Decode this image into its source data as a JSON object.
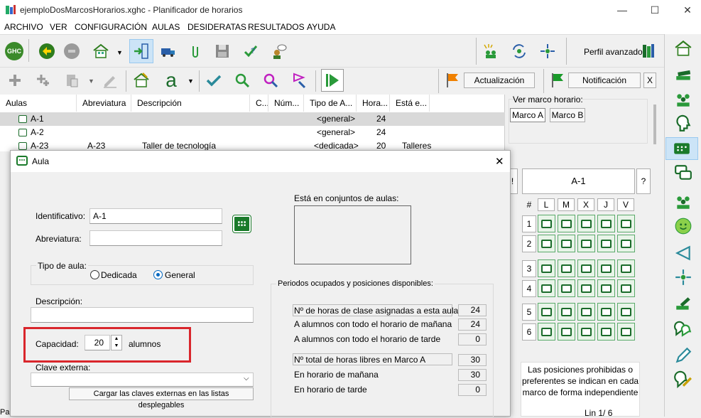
{
  "window": {
    "title": "ejemploDosMarcosHorarios.xghc - Planificador de horarios",
    "minimize": "—",
    "maximize": "☐",
    "close": "✕"
  },
  "menu": [
    "ARCHIVO",
    "VER",
    "CONFIGURACIÓN",
    "AULAS",
    "DESIDERATAS",
    "RESULTADOS",
    "AYUDA"
  ],
  "toolbar": {
    "ghc_label": "GHC",
    "perfil_label": "Perfil avanzado",
    "actualizacion_label": "Actualización",
    "notificacion_label": "Notificación",
    "close_x": "X",
    "font_a": "a"
  },
  "table": {
    "headers": [
      "Aulas",
      "Abreviatura",
      "Descripción",
      "C...",
      "Núm...",
      "Tipo de A...",
      "Hora...",
      "Está e..."
    ],
    "rows": [
      {
        "aula": "A-1",
        "abrev": "",
        "desc": "",
        "tipo": "<general>",
        "horas": "24",
        "esta": ""
      },
      {
        "aula": "A-2",
        "abrev": "",
        "desc": "",
        "tipo": "<general>",
        "horas": "24",
        "esta": ""
      },
      {
        "aula": "A-23",
        "abrev": "A-23",
        "desc": "Taller de tecnología",
        "tipo": "<dedicada>",
        "horas": "20",
        "esta": "Talleres"
      }
    ]
  },
  "right": {
    "ver_marco": "Ver marco horario:",
    "marco_a": "Marco A",
    "marco_b": "Marco B",
    "excl": "!",
    "aula_name": "A-1",
    "question": "?",
    "hash": "#",
    "days": [
      "L",
      "M",
      "X",
      "J",
      "V"
    ],
    "periods": [
      "1",
      "2",
      "3",
      "4",
      "5",
      "6"
    ],
    "note": "Las posiciones prohibidas o preferentes se indican en cada marco de forma independiente",
    "lin": "Lin 1/ 6"
  },
  "dialog": {
    "title": "Aula",
    "close": "✕",
    "identificativo_label": "Identificativo:",
    "identificativo_value": "A-1",
    "abreviatura_label": "Abreviatura:",
    "abreviatura_value": "",
    "tipo_label": "Tipo de aula:",
    "dedicada": "Dedicada",
    "general": "General",
    "descripcion_label": "Descripción:",
    "descripcion_value": "",
    "capacidad_label": "Capacidad:",
    "capacidad_value": "20",
    "alumnos": "alumnos",
    "clave_label": "Clave externa:",
    "clave_value": "",
    "cargar_btn": "Cargar las claves externas en las listas desplegables",
    "conjuntos_label": "Está en conjuntos de aulas:",
    "periodos_label": "Periodos ocupados y posiciones disponibles:",
    "stats": [
      {
        "label": "Nº de horas de clase asignadas a esta aula",
        "value": "24"
      },
      {
        "label": "A alumnos con todo el horario de mañana",
        "value": "24"
      },
      {
        "label": "A alumnos con todo el horario de tarde",
        "value": "0"
      },
      {
        "label": "Nº total de horas libres en Marco A",
        "value": "30"
      },
      {
        "label": "En horario de mañana",
        "value": "30"
      },
      {
        "label": "En horario de tarde",
        "value": "0"
      }
    ]
  },
  "colors": {
    "accent": "#cc0000",
    "grid_green": "#1a6b2a",
    "selection": "#d9d9d9"
  },
  "status": {
    "left": "Pa"
  }
}
